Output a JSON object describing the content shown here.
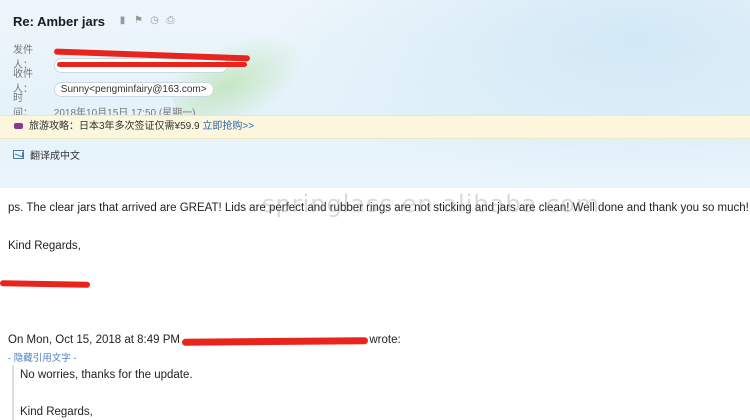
{
  "subject": "Re: Amber jars",
  "header_icons": [
    "bookmark-icon",
    "flag-icon",
    "clock-icon",
    "print-icon"
  ],
  "sender": {
    "label": "发件人："
  },
  "recipient": {
    "label": "收件人：",
    "value": "Sunny<pengminfairy@163.com>"
  },
  "time": {
    "label": "时　间：",
    "value": "2018年10月15日 17:50 (星期一)"
  },
  "ad": {
    "text": "旅游攻略：日本3年多次签证仅需¥59.9",
    "link": "立即抢购>>"
  },
  "translate": {
    "label": "翻译成中文"
  },
  "email_body": {
    "line1": "ps. The clear jars that arrived are GREAT! Lids are perfect and rubber rings are not sticking and jars are clean! Well done and thank you so much!",
    "regards": "Kind Regards,",
    "quote_intro_prefix": "On Mon, Oct 15, 2018 at 8:49 PM",
    "quote_intro_suffix": "wrote:",
    "hide_quote": "- 隐藏引用文字 -",
    "quoted_line1": "No worries, thanks for the update.",
    "quoted_regards": "Kind Regards,"
  },
  "watermark": "springlass.en.alibaba.com"
}
